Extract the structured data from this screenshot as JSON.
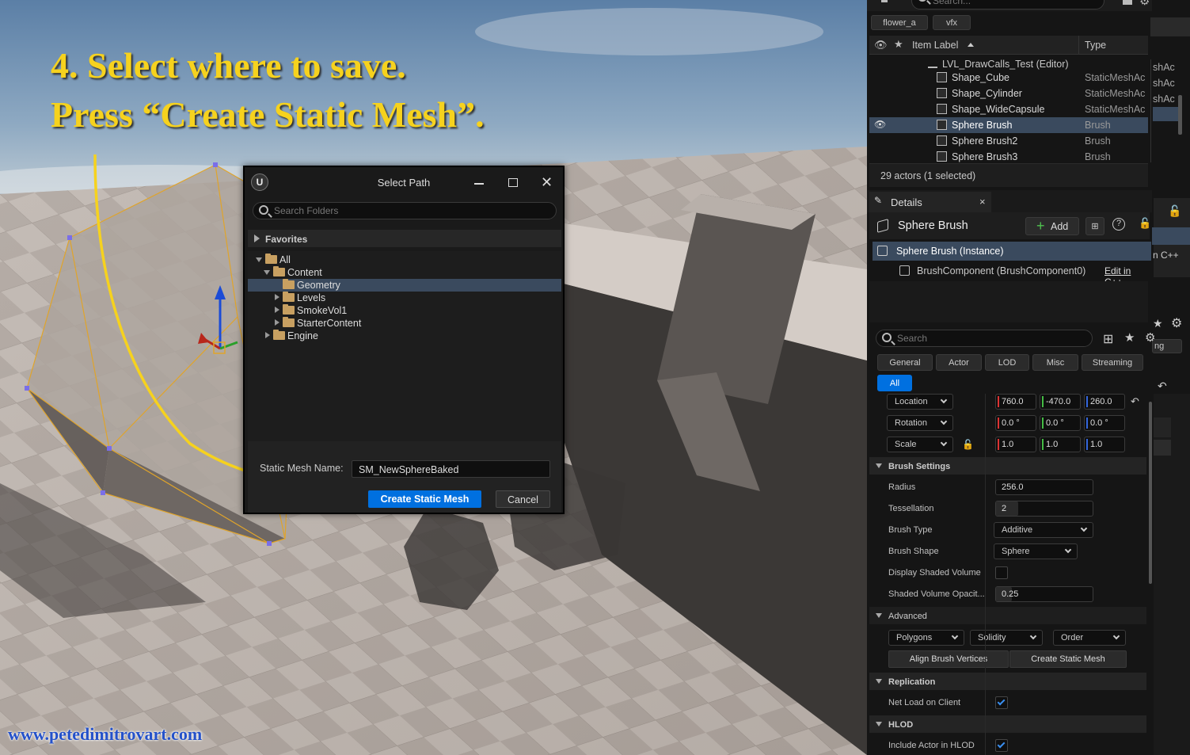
{
  "caption": {
    "line1": "4. Select where to save.",
    "line2": "Press “Create Static Mesh”."
  },
  "watermark": "www.petedimitrovart.com",
  "dialog": {
    "title": "Select Path",
    "search_placeholder": "Search Folders",
    "favorites": "Favorites",
    "tree": [
      {
        "label": "All",
        "depth": 0
      },
      {
        "label": "Content",
        "depth": 1
      },
      {
        "label": "Geometry",
        "depth": 2,
        "selected": true
      },
      {
        "label": "Levels",
        "depth": 2
      },
      {
        "label": "SmokeVol1",
        "depth": 2
      },
      {
        "label": "StarterContent",
        "depth": 2
      },
      {
        "label": "Engine",
        "depth": 1
      }
    ],
    "name_label": "Static Mesh Name:",
    "name_value": "SM_NewSphereBaked",
    "create_button": "Create Static Mesh",
    "cancel_button": "Cancel"
  },
  "outliner": {
    "search_placeholder": "Search...",
    "filters": [
      "flower_a",
      "vfx"
    ],
    "col_label": "Item Label",
    "col_type": "Type",
    "world": "LVL_DrawCalls_Test (Editor)",
    "rows": [
      {
        "label": "Shape_Cube",
        "type": "StaticMeshAc"
      },
      {
        "label": "Shape_Cylinder",
        "type": "StaticMeshAc"
      },
      {
        "label": "Shape_WideCapsule",
        "type": "StaticMeshAc"
      },
      {
        "label": "Sphere Brush",
        "type": "Brush",
        "selected": true
      },
      {
        "label": "Sphere Brush2",
        "type": "Brush"
      },
      {
        "label": "Sphere Brush3",
        "type": "Brush"
      }
    ],
    "count": "29 actors (1 selected)",
    "side_clip": [
      "shAc",
      "shAc",
      "shAc"
    ]
  },
  "details": {
    "tab": "Details",
    "actor": "Sphere Brush",
    "add": "Add",
    "instance": "Sphere Brush (Instance)",
    "component": "BrushComponent (BrushComponent0)",
    "edit_cpp": "Edit in C++",
    "side_cpp": "n C++",
    "side_ng": "ng",
    "search_placeholder": "Search",
    "tabs": [
      "General",
      "Actor",
      "LOD",
      "Misc",
      "Streaming"
    ],
    "all_tab": "All",
    "transform": [
      {
        "label": "Location",
        "x": "760.0",
        "y": "-470.0",
        "z": "260.0"
      },
      {
        "label": "Rotation",
        "x": "0.0 °",
        "y": "0.0 °",
        "z": "0.0 °"
      },
      {
        "label": "Scale",
        "x": "1.0",
        "y": "1.0",
        "z": "1.0"
      }
    ],
    "brush_settings": "Brush Settings",
    "radius_label": "Radius",
    "radius": "256.0",
    "tess_label": "Tessellation",
    "tess": "2",
    "type_label": "Brush Type",
    "type": "Additive",
    "shape_label": "Brush Shape",
    "shape": "Sphere",
    "shaded_label": "Display Shaded Volume",
    "opacity_label": "Shaded Volume Opacit...",
    "opacity": "0.25",
    "advanced": "Advanced",
    "adv_dd": [
      "Polygons",
      "Solidity",
      "Order"
    ],
    "align_button": "Align Brush Vertices",
    "create_button": "Create Static Mesh",
    "replication": "Replication",
    "netload_label": "Net Load on Client",
    "netload": true,
    "hlod": "HLOD",
    "include_label": "Include Actor in HLOD",
    "include": true
  },
  "colors": {
    "accent": "#0070e0",
    "caption": "#f6d21e",
    "selection": "#3a4a5e"
  }
}
